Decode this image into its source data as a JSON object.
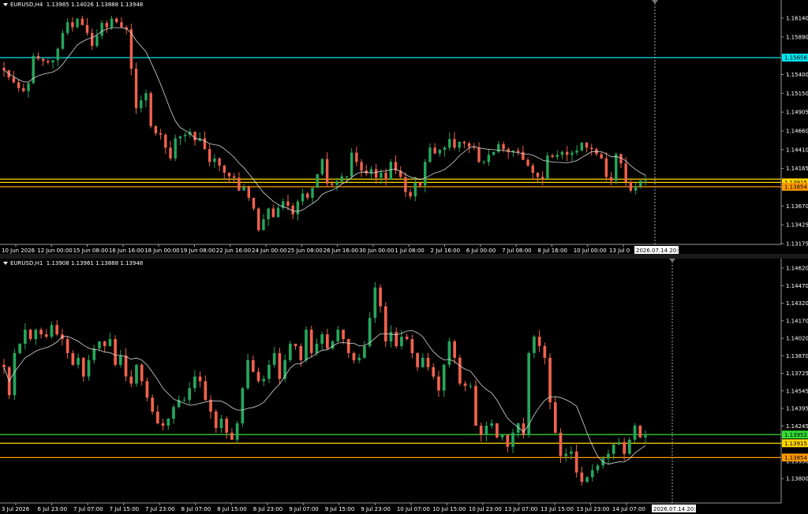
{
  "chart_data": [
    {
      "type": "candlestick",
      "symbol": "EURUSD,H4",
      "header_values": "1.13985 1.14026 1.13888 1.13948",
      "ylim": [
        1.1305,
        1.1635
      ],
      "y_ticks": [
        "1.16140",
        "1.15890",
        "1.15645",
        "1.15400",
        "1.15150",
        "1.14905",
        "1.14660",
        "1.14410",
        "1.14165",
        "1.13915",
        "1.13670",
        "1.13425",
        "1.13175"
      ],
      "x_ticks": [
        "10 Jun 2026",
        "12 Jun 00:00",
        "15 Jun 08:00",
        "16 Jun 16:00",
        "18 Jun 00:00",
        "19 Jun 08:00",
        "22 Jun 16:00",
        "24 Jun 00:00",
        "25 Jun 08:00",
        "26 Jun 16:00",
        "30 Jun 00:00",
        "1 Jul 08:00",
        "2 Jul 16:00",
        "6 Jul 00:00",
        "7 Jul 08:00",
        "8 Jul 16:00",
        "10 Jul 00:00",
        "13 Jul 0"
      ],
      "cursor_label": "2026.07.14 20:00",
      "hlines": [
        {
          "value": 1.15656,
          "label": "1.15656",
          "color": "#00e5ee"
        },
        {
          "value": 1.1396,
          "label": "",
          "color": "#ffd700"
        },
        {
          "value": 1.13915,
          "label": "1.13915",
          "color": "#ffd700"
        },
        {
          "value": 1.13854,
          "label": "1.13854",
          "color": "#ff9900"
        }
      ],
      "bull_color": "#26a65b",
      "bear_color": "#f0624d",
      "ma_color": "#d8d8d8",
      "closes": [
        1.1548,
        1.1538,
        1.1531,
        1.1523,
        1.1519,
        1.153,
        1.1568,
        1.1564,
        1.1561,
        1.1559,
        1.1562,
        1.1578,
        1.16,
        1.1615,
        1.1608,
        1.162,
        1.1611,
        1.16,
        1.1582,
        1.1596,
        1.1614,
        1.1608,
        1.162,
        1.1615,
        1.1608,
        1.1605,
        1.155,
        1.1495,
        1.1506,
        1.1516,
        1.147,
        1.146,
        1.1458,
        1.144,
        1.1425,
        1.1453,
        1.1456,
        1.1458,
        1.1462,
        1.145,
        1.1453,
        1.1438,
        1.142,
        1.1425,
        1.1415,
        1.1405,
        1.14,
        1.1398,
        1.138,
        1.1385,
        1.137,
        1.1355,
        1.1325,
        1.134,
        1.1355,
        1.1343,
        1.1356,
        1.1365,
        1.1359,
        1.1347,
        1.1365,
        1.1376,
        1.137,
        1.1384,
        1.1403,
        1.1424,
        1.139,
        1.1388,
        1.1393,
        1.14,
        1.14,
        1.1433,
        1.142,
        1.1408,
        1.1404,
        1.141,
        1.1398,
        1.1405,
        1.1395,
        1.142,
        1.1408,
        1.1399,
        1.1378,
        1.1372,
        1.1391,
        1.1387,
        1.142,
        1.144,
        1.1432,
        1.1437,
        1.144,
        1.1452,
        1.144,
        1.1448,
        1.1446,
        1.1441,
        1.144,
        1.142,
        1.142,
        1.143,
        1.1434,
        1.1445,
        1.1438,
        1.1434,
        1.1436,
        1.1434,
        1.1423,
        1.1415,
        1.1405,
        1.1399,
        1.1397,
        1.1429,
        1.1427,
        1.143,
        1.1434,
        1.143,
        1.1433,
        1.1436,
        1.1447,
        1.144,
        1.1438,
        1.1431,
        1.1425,
        1.1399,
        1.1394,
        1.1431,
        1.1418,
        1.1392,
        1.138,
        1.1386,
        1.1394,
        1.13948
      ]
    },
    {
      "type": "candlestick",
      "symbol": "EURUSD,H1",
      "header_values": "1.13908 1.13961 1.13888 1.13948",
      "ylim": [
        1.1366,
        1.1467
      ],
      "y_ticks": [
        "1.14620",
        "1.14470",
        "1.14320",
        "1.14170",
        "1.14020",
        "1.13870",
        "1.13725",
        "1.14545",
        "1.14395",
        "1.14245",
        "1.14095",
        "1.13950",
        "1.13800"
      ],
      "x_ticks": [
        "3 Jul 2026",
        "6 Jul 23:00",
        "7 Jul 07:00",
        "7 Jul 15:00",
        "7 Jul 23:00",
        "8 Jul 07:00",
        "8 Jul 15:00",
        "8 Jul 23:00",
        "9 Jul 07:00",
        "9 Jul 15:00",
        "9 Jul 23:00",
        "10 Jul 07:00",
        "10 Jul 15:00",
        "10 Jul 23:00",
        "13 Jul 07:00",
        "13 Jul 15:00",
        "13 Jul 23:00",
        "14 Jul 07:00"
      ],
      "cursor_label": "2026.07.14 20:00",
      "hlines": [
        {
          "value": 1.13952,
          "label": "1.13952",
          "color": "#33dd33"
        },
        {
          "value": 1.13915,
          "label": "1.13915",
          "color": "#ffd700"
        },
        {
          "value": 1.13854,
          "label": "1.13854",
          "color": "#ff9900"
        }
      ],
      "bull_color": "#26a65b",
      "bear_color": "#f0624d",
      "ma_color": "#d8d8d8",
      "closes": [
        1.1424,
        1.1412,
        1.143,
        1.1434,
        1.144,
        1.1436,
        1.144,
        1.1438,
        1.1437,
        1.1442,
        1.1438,
        1.1436,
        1.143,
        1.1425,
        1.1428,
        1.142,
        1.1427,
        1.1432,
        1.1435,
        1.1433,
        1.1436,
        1.1425,
        1.1429,
        1.142,
        1.1417,
        1.1425,
        1.1418,
        1.1411,
        1.1405,
        1.14,
        1.1399,
        1.1402,
        1.1407,
        1.141,
        1.141,
        1.1415,
        1.142,
        1.1418,
        1.141,
        1.1405,
        1.1398,
        1.1402,
        1.1396,
        1.1393,
        1.14,
        1.1415,
        1.1427,
        1.1422,
        1.1418,
        1.1419,
        1.1425,
        1.143,
        1.1419,
        1.1427,
        1.1434,
        1.1433,
        1.1427,
        1.144,
        1.143,
        1.1434,
        1.1438,
        1.1432,
        1.1435,
        1.144,
        1.1436,
        1.143,
        1.1427,
        1.1428,
        1.1433,
        1.1445,
        1.1458,
        1.145,
        1.1435,
        1.1439,
        1.1433,
        1.1437,
        1.1436,
        1.143,
        1.1424,
        1.1428,
        1.1424,
        1.142,
        1.1414,
        1.1425,
        1.1435,
        1.1428,
        1.1417,
        1.1416,
        1.1416,
        1.1399,
        1.1395,
        1.1399,
        1.14,
        1.1394,
        1.1395,
        1.139,
        1.1396,
        1.14,
        1.1395,
        1.143,
        1.1437,
        1.1433,
        1.1428,
        1.1409,
        1.1396,
        1.1386,
        1.1387,
        1.1388,
        1.1379,
        1.1375,
        1.1377,
        1.138,
        1.1382,
        1.1385,
        1.1387,
        1.1391,
        1.1392,
        1.1387,
        1.1393,
        1.1399,
        1.1394,
        1.13948
      ]
    }
  ]
}
